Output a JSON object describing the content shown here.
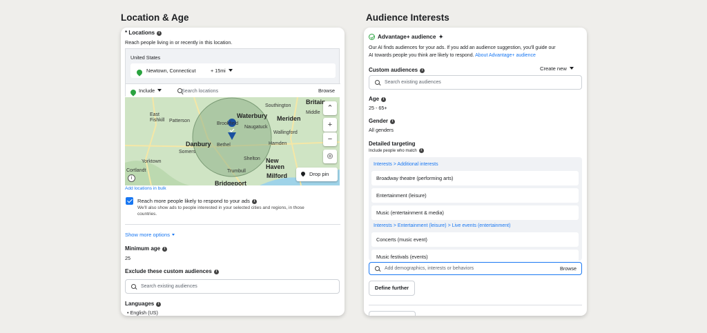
{
  "left": {
    "title": "Location & Age",
    "locations_label": "* Locations",
    "locations_desc": "Reach people living in or recently in this location.",
    "country": "United States",
    "location_name": "Newtown, Connecticut",
    "radius": "+ 15mi",
    "include_label": "Include",
    "search_placeholder": "Search locations",
    "browse": "Browse",
    "map": {
      "cities": [
        "Britain",
        "Waterbury",
        "Southington",
        "East Fishkill",
        "Patterson",
        "Brookfield",
        "Naugatuck",
        "Meriden",
        "Danbury",
        "Bethel",
        "Wallingford",
        "Hamden",
        "Somers",
        "Shelton",
        "Yorktown",
        "New Haven",
        "Cortlandt",
        "Trumbull",
        "Milford",
        "Bridgeport",
        "Middle"
      ],
      "drop_pin": "Drop pin",
      "zoom_in": "+",
      "zoom_out": "−",
      "collapse": "⌃"
    },
    "add_bulk": "Add locations in bulk",
    "reach_more_title": "Reach more people likely to respond to your ads",
    "reach_more_desc": "We'll also show ads to people interested in your selected cities and regions, in those countries.",
    "show_more": "Show more options",
    "min_age_label": "Minimum age",
    "min_age_value": "25",
    "exclude_label": "Exclude these custom audiences",
    "exclude_placeholder": "Search existing audiences",
    "languages_label": "Languages",
    "language_item": "English (US)"
  },
  "right": {
    "title": "Audience Interests",
    "advantage_title": "Advantage+ audience",
    "advantage_desc_1": "Our AI finds audiences for your ads. If you add an audience suggestion, you'll guide our",
    "advantage_desc_2": "AI towards people you think are likely to respond.",
    "advantage_link": "About Advantage+ audience",
    "custom_label": "Custom audiences",
    "create_new": "Create new",
    "custom_placeholder": "Search existing audiences",
    "age_label": "Age",
    "age_value": "25 - 65+",
    "gender_label": "Gender",
    "gender_value": "All genders",
    "detailed_label": "Detailed targeting",
    "detailed_sub": "Include people who match",
    "cat_1": "Interests > Additional interests",
    "items_1": [
      "Broadway theatre (performing arts)",
      "Entertainment (leisure)",
      "Music (entertainment & media)"
    ],
    "cat_2": "Interests > Entertainment (leisure) > Live events (entertainment)",
    "items_2": [
      "Concerts (music event)",
      "Music festivals (events)"
    ],
    "add_placeholder": "Add demographics, interests or behaviors",
    "browse": "Browse",
    "define_further": "Define further"
  },
  "colors": {
    "accent": "#1877f2",
    "pin": "#2aa33f",
    "map_circle": "#8fb08a"
  }
}
